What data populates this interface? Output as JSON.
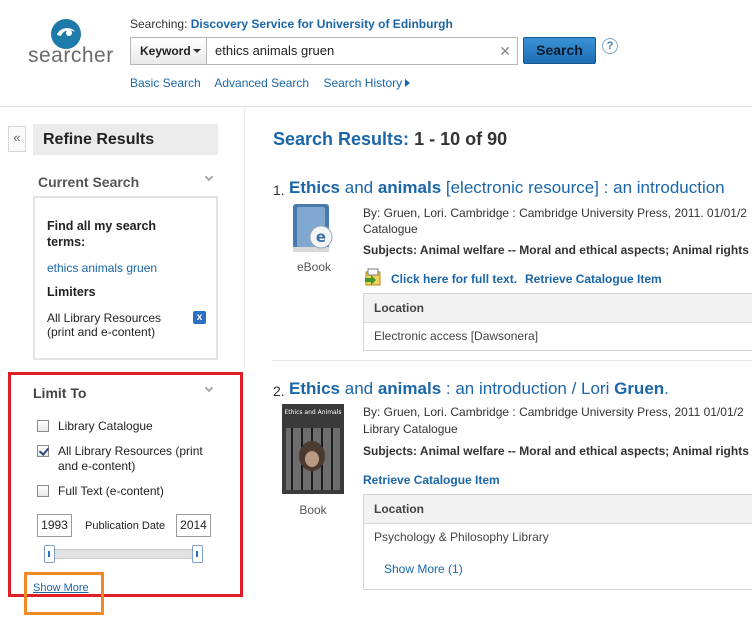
{
  "header": {
    "logo_text": "searcher",
    "searching_label": "Searching:",
    "searching_source": "Discovery Service for University of Edinburgh",
    "field_select": "Keyword",
    "query": "ethics animals gruen",
    "search_button": "Search",
    "help": "?",
    "nav": [
      "Basic Search",
      "Advanced Search",
      "Search History"
    ]
  },
  "sidebar": {
    "collapse": "«",
    "refine_title": "Refine Results",
    "current_search": {
      "title": "Current Search",
      "find_label": "Find all my search terms:",
      "terms": "ethics animals gruen",
      "limiters_label": "Limiters",
      "limiter_value": "All Library Resources (print and e-content)",
      "remove": "x"
    },
    "limit_to": {
      "title": "Limit To",
      "options": [
        {
          "label": "Library Catalogue",
          "checked": false
        },
        {
          "label": "All Library Resources (print and e-content)",
          "checked": true
        },
        {
          "label": "Full Text (e-content)",
          "checked": false
        }
      ],
      "year_from": "1993",
      "year_to": "2014",
      "pub_date_label": "Publication Date",
      "show_more": "Show More"
    }
  },
  "results": {
    "label": "Search Results:",
    "count": "1 - 10 of 90",
    "items": [
      {
        "num": "1.",
        "title_b1": "Ethics",
        "title_n1": " and ",
        "title_b2": "animals",
        "title_rest": " [electronic resource] : an introduction",
        "type": "eBook",
        "line1": "By: Gruen, Lori. Cambridge : Cambridge University Press, 2011. 01/01/2",
        "line2": "Catalogue",
        "subjects": "Subjects: Animal welfare -- Moral and ethical aspects; Animal rights",
        "fulltext": "Click here for full text.",
        "retrieve": "Retrieve Catalogue Item",
        "location_header": "Location",
        "location": "Electronic access [Dawsonera]"
      },
      {
        "num": "2.",
        "title_b1": "Ethics",
        "title_n1": " and ",
        "title_b2": "animals",
        "title_rest": " : an introduction / Lori ",
        "title_b3": "Gruen",
        "title_end": ".",
        "type": "Book",
        "cover_title": "Ethics and Animals",
        "line1": "By: Gruen, Lori. Cambridge : Cambridge University Press, 2011 01/01/2",
        "line2": "Library Catalogue",
        "subjects": "Subjects: Animal welfare -- Moral and ethical aspects; Animal rights",
        "retrieve": "Retrieve Catalogue Item",
        "location_header": "Location",
        "location": "Psychology & Philosophy Library",
        "show_more": "Show More (1)"
      }
    ]
  }
}
